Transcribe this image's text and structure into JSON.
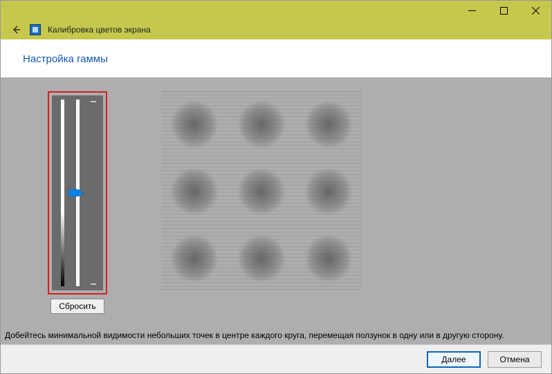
{
  "window": {
    "title": "Калибровка цветов экрана"
  },
  "page": {
    "heading": "Настройка гаммы",
    "instruction": "Добейтесь минимальной видимости небольших точек в центре каждого круга, перемещая ползунок в одну или в другую сторону."
  },
  "controls": {
    "reset_label": "Сбросить",
    "reset_underline_char": "С"
  },
  "footer": {
    "next_label": "Далее",
    "cancel_label": "Отмена"
  },
  "slider": {
    "value_percent": 50
  }
}
